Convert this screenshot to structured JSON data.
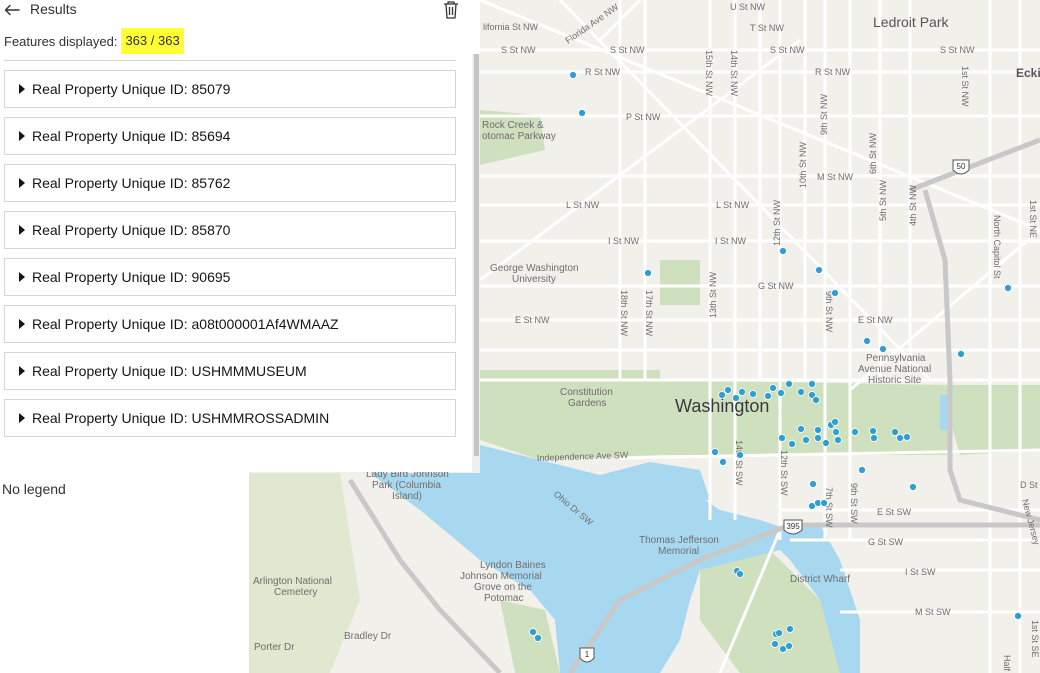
{
  "panel": {
    "title": "Results",
    "features_label": "Features displayed:",
    "features_count": "363 / 363",
    "items": [
      {
        "label": "Real Property Unique ID: 85079"
      },
      {
        "label": "Real Property Unique ID: 85694"
      },
      {
        "label": "Real Property Unique ID: 85762"
      },
      {
        "label": "Real Property Unique ID: 85870"
      },
      {
        "label": "Real Property Unique ID: 90695"
      },
      {
        "label": "Real Property Unique ID: a08t000001Af4WMAAZ"
      },
      {
        "label": "Real Property Unique ID: USHMMMUSEUM"
      },
      {
        "label": "Real Property Unique ID: USHMMROSSADMIN"
      }
    ]
  },
  "legend": {
    "text": "No legend"
  },
  "map": {
    "colors": {
      "water": "#a8d8f0",
      "park": "#cfe0bf",
      "land": "#f2f0eb",
      "road": "#ffffff",
      "point": "#2f9fd3"
    },
    "labels": {
      "ledroit": "Ledroit Park",
      "eck": "Ecki",
      "washington": "Washington",
      "rock_creek_1": "Rock Creek &",
      "rock_creek_2": "otomac Parkway",
      "gwu_1": "George Washington",
      "gwu_2": "University",
      "constitution_1": "Constitution",
      "constitution_2": "Gardens",
      "penn_1": "Pennsylvania",
      "penn_2": "Avenue National",
      "penn_3": "Historic Site",
      "lbj_grove_1": "Lyndon Baines",
      "lbj_grove_2": "Johnson Memorial",
      "lbj_grove_3": "Grove on the",
      "lbj_grove_4": "Potomac",
      "lady_bird_1": "Lady Bird Johnson",
      "lady_bird_2": "Park (Columbia",
      "lady_bird_3": "Island)",
      "jefferson_1": "Thomas Jefferson",
      "jefferson_2": "Memorial",
      "arlington_1": "Arlington National",
      "arlington_2": "Cemetery",
      "district_wharf": "District Wharf",
      "florida_ave": "Florida Ave NW",
      "california": "lifornia St NW",
      "u_st": "U St NW",
      "t_st": "T St NW",
      "s_st_1": "S St NW",
      "s_st_2": "S St NW",
      "s_st_3": "S St NW",
      "s_st_4": "S St NW",
      "r_st_1": "R St NW",
      "r_st_2": "R St NW",
      "p_st": "P St NW",
      "m_st": "M St NW",
      "l_st_1": "L St NW",
      "l_st_2": "L St NW",
      "i_st_1": "I St NW",
      "i_st_2": "I St NW",
      "g_st": "G St NW",
      "e_st_1": "E St NW",
      "e_st_2": "E St NW",
      "independence": "Independence Ave SW",
      "ohio_dr": "Ohio Dr SW",
      "e_st_sw": "E St SW",
      "g_st_sw": "G St SW",
      "i_st_sw": "I St SW",
      "m_st_sw": "M St SW",
      "d_st": "D St",
      "st_15": "15th St NW",
      "st_14_a": "14th St NW",
      "st_13": "13th St NW",
      "st_12": "12th St NW",
      "st_10": "10th St NW",
      "st_9": "9th St NW",
      "st_9b": "9th St NW",
      "st_6": "6th St NW",
      "st_5": "5th St NW",
      "st_4": "4th St NW",
      "st_18": "18th St NW",
      "st_17": "17th St NW",
      "st_14_sw": "14th St SW",
      "st_12_sw": "12th St SW",
      "st_9_sw": "9th St SW",
      "st_7_sw": "7th St SW",
      "north_capitol": "North Capitol St",
      "first_st": "1st St NW",
      "first_ne": "1st St NE",
      "new_jersey": "New Jersey",
      "first_se": "1st St SE",
      "half": "Half",
      "hwy_50": "50",
      "hwy_395": "395",
      "hwy_1": "1",
      "bradley": "Bradley Dr",
      "porter": "Porter Dr"
    }
  }
}
